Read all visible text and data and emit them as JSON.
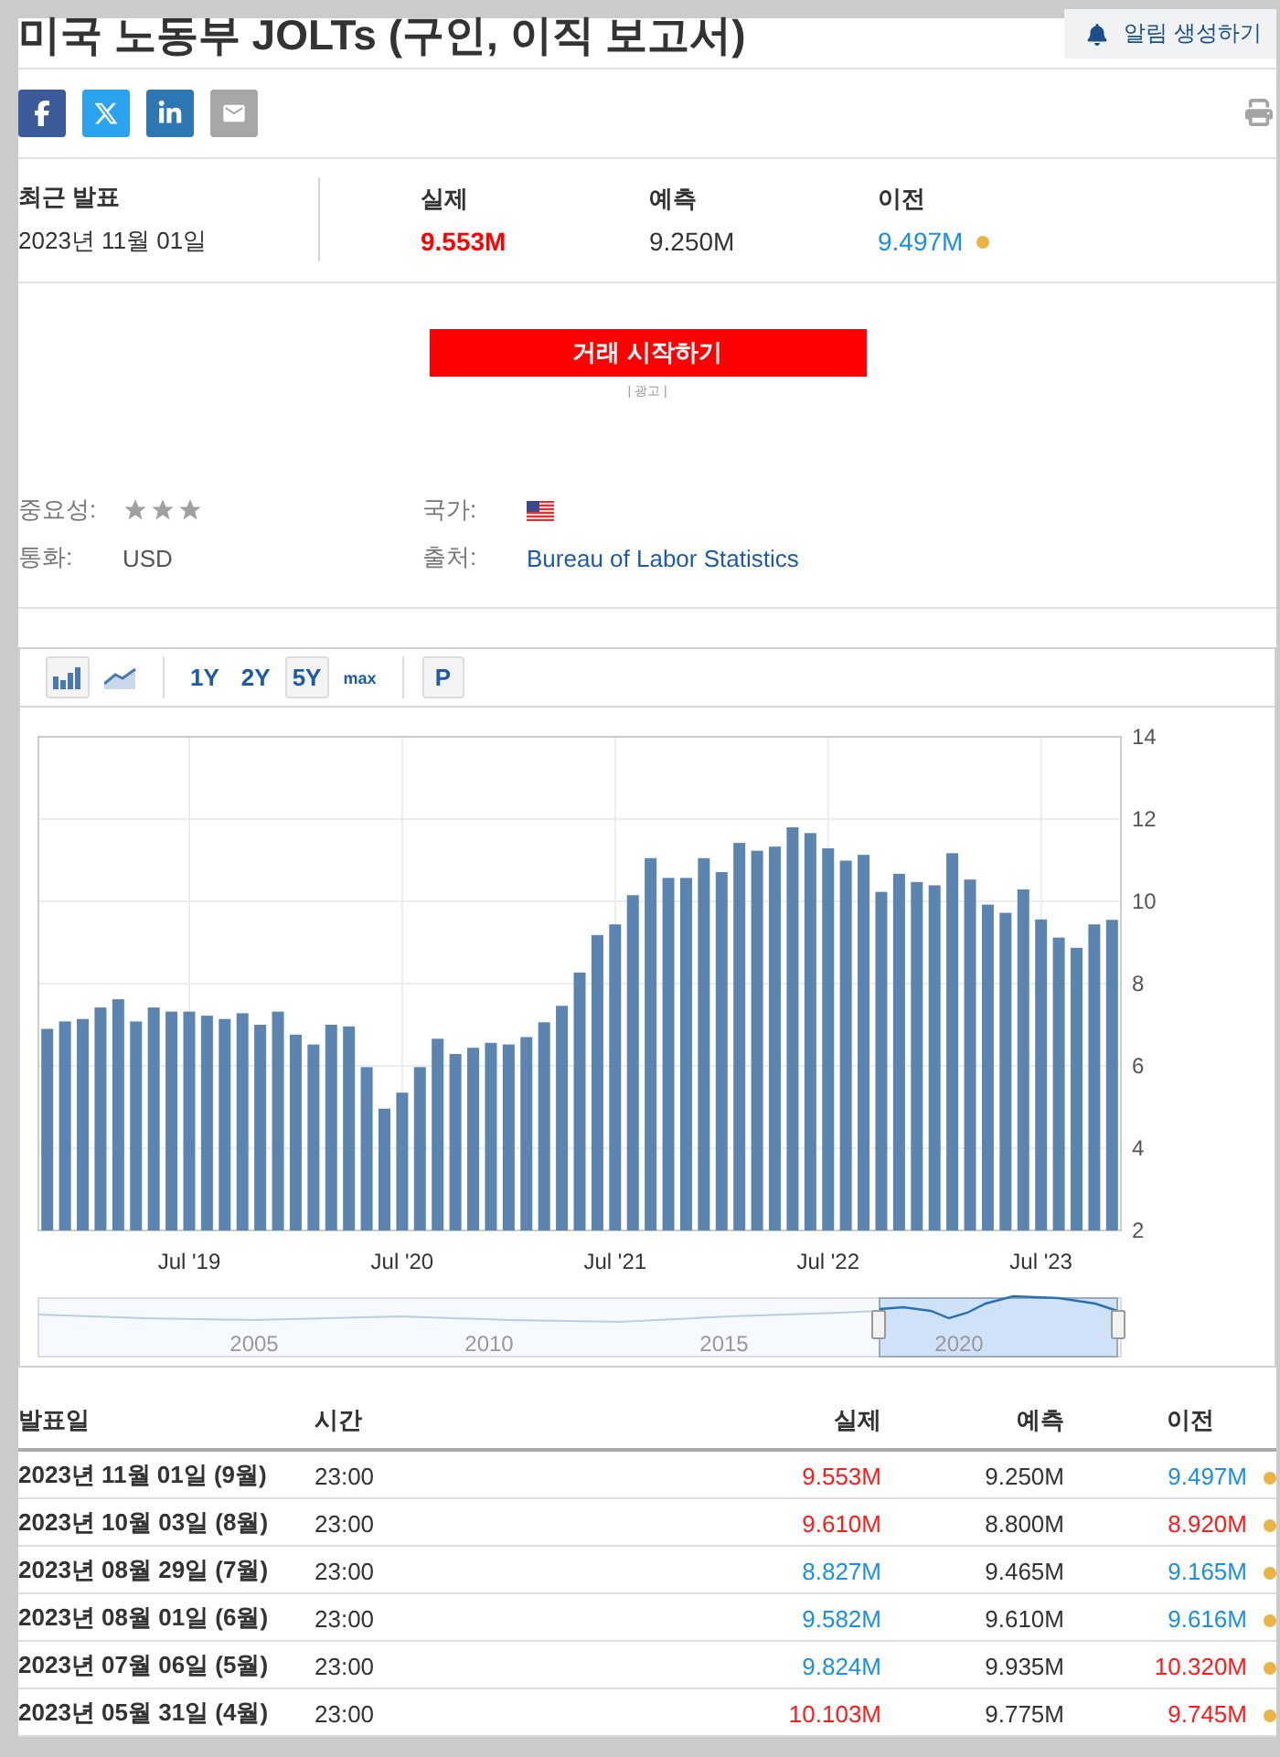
{
  "title": "미국 노동부 JOLTs (구인, 이직 보고서)",
  "alert_button": "알림 생성하기",
  "share_buttons": [
    {
      "kind": "facebook"
    },
    {
      "kind": "x"
    },
    {
      "kind": "linkedin"
    },
    {
      "kind": "email"
    }
  ],
  "latest": {
    "label": "최근 발표",
    "date": "2023년 11월 01일",
    "columns": [
      {
        "label": "실제",
        "value": "9.553M",
        "color": "#ff0000",
        "bold": true
      },
      {
        "label": "예측",
        "value": "9.250M",
        "color": "#333333",
        "bold": false
      },
      {
        "label": "이전",
        "value": "9.497M",
        "color": "#1a8fe3",
        "bold": false,
        "revised": true
      }
    ]
  },
  "trade_button": "거래 시작하기",
  "ad_label": "| 광고 |",
  "info": {
    "importance_label": "중요성:",
    "stars": 3,
    "country_label": "국가:",
    "currency_label": "통화:",
    "currency": "USD",
    "source_label": "출처:",
    "source": "Bureau of Labor Statistics"
  },
  "toolbar": {
    "chart_types": [
      {
        "kind": "bar",
        "selected": true
      },
      {
        "kind": "line",
        "selected": false
      }
    ],
    "ranges": [
      {
        "label": "1Y",
        "selected": false
      },
      {
        "label": "2Y",
        "selected": false
      },
      {
        "label": "5Y",
        "selected": true
      },
      {
        "label": "max",
        "selected": false
      }
    ],
    "p_button": "P"
  },
  "chart_data": {
    "type": "bar",
    "categories": [
      null,
      null,
      null,
      null,
      null,
      null,
      null,
      null,
      "Jul '19",
      null,
      null,
      null,
      null,
      null,
      null,
      null,
      null,
      null,
      null,
      null,
      "Jul '20",
      null,
      null,
      null,
      null,
      null,
      null,
      null,
      null,
      null,
      null,
      null,
      "Jul '21",
      null,
      null,
      null,
      null,
      null,
      null,
      null,
      null,
      null,
      null,
      null,
      "Jul '22",
      null,
      null,
      null,
      null,
      null,
      null,
      null,
      null,
      null,
      null,
      null,
      "Jul '23",
      null,
      null,
      null,
      null
    ],
    "values": [
      6.9,
      7.08,
      7.14,
      7.42,
      7.62,
      7.08,
      7.42,
      7.32,
      7.32,
      7.22,
      7.14,
      7.28,
      7.0,
      7.32,
      6.76,
      6.52,
      7.0,
      6.96,
      5.97,
      4.96,
      5.35,
      5.97,
      6.66,
      6.29,
      6.44,
      6.56,
      6.52,
      6.7,
      7.06,
      7.46,
      8.27,
      9.18,
      9.44,
      10.15,
      11.05,
      10.57,
      10.57,
      11.05,
      10.71,
      11.42,
      11.23,
      11.33,
      11.8,
      11.66,
      11.29,
      10.99,
      11.13,
      10.23,
      10.67,
      10.47,
      10.39,
      11.17,
      10.53,
      9.92,
      9.72,
      10.29,
      9.56,
      9.12,
      8.87,
      9.44,
      9.55
    ],
    "ylim": [
      2,
      14
    ],
    "yticks": [
      2,
      4,
      6,
      8,
      10,
      12,
      14
    ],
    "grid": true
  },
  "navigator": {
    "labels": [
      "2005",
      "2010",
      "2015",
      "2020"
    ]
  },
  "table": {
    "columns": [
      "발표일",
      "시간",
      "실제",
      "예측",
      "이전"
    ],
    "rows": [
      {
        "date": "2023년 11월 01일 (9월)",
        "time": "23:00",
        "actual": {
          "text": "9.553M",
          "color": "#ff1a1a"
        },
        "forecast": "9.250M",
        "previous": {
          "text": "9.497M",
          "color": "#1a8fe3"
        },
        "revised": true
      },
      {
        "date": "2023년 10월 03일 (8월)",
        "time": "23:00",
        "actual": {
          "text": "9.610M",
          "color": "#ff1a1a"
        },
        "forecast": "8.800M",
        "previous": {
          "text": "8.920M",
          "color": "#ff1a1a"
        },
        "revised": true
      },
      {
        "date": "2023년 08월 29일 (7월)",
        "time": "23:00",
        "actual": {
          "text": "8.827M",
          "color": "#1a8fe3"
        },
        "forecast": "9.465M",
        "previous": {
          "text": "9.165M",
          "color": "#1a8fe3"
        },
        "revised": true
      },
      {
        "date": "2023년 08월 01일 (6월)",
        "time": "23:00",
        "actual": {
          "text": "9.582M",
          "color": "#1a8fe3"
        },
        "forecast": "9.610M",
        "previous": {
          "text": "9.616M",
          "color": "#1a8fe3"
        },
        "revised": true
      },
      {
        "date": "2023년 07월 06일 (5월)",
        "time": "23:00",
        "actual": {
          "text": "9.824M",
          "color": "#1a8fe3"
        },
        "forecast": "9.935M",
        "previous": {
          "text": "10.320M",
          "color": "#ff1a1a"
        },
        "revised": true
      },
      {
        "date": "2023년 05월 31일 (4월)",
        "time": "23:00",
        "actual": {
          "text": "10.103M",
          "color": "#ff1a1a"
        },
        "forecast": "9.775M",
        "previous": {
          "text": "9.745M",
          "color": "#ff1a1a"
        },
        "revised": true
      }
    ]
  }
}
